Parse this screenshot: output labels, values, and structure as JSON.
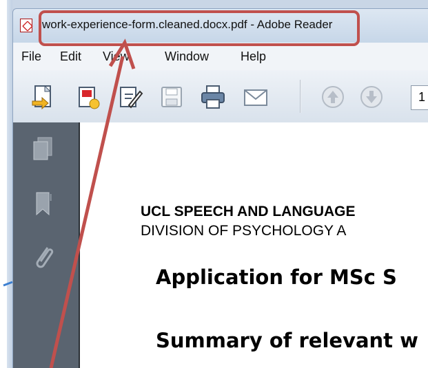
{
  "window": {
    "title": "work-experience-form.cleaned.docx.pdf - Adobe Reader"
  },
  "menu": {
    "items": [
      "File",
      "Edit",
      "View",
      "Window",
      "Help"
    ]
  },
  "toolbar": {
    "icons": [
      "open-icon",
      "create-pdf-icon",
      "sign-edit-icon",
      "save-icon",
      "print-icon",
      "email-icon",
      "previous-page-icon",
      "next-page-icon"
    ],
    "page_number": "1"
  },
  "nav_pane": {
    "icons": [
      "pages-icon",
      "bookmark-icon",
      "attachment-icon"
    ]
  },
  "document": {
    "line1": "UCL SPEECH AND LANGUAGE",
    "line2": "DIVISION OF PSYCHOLOGY A",
    "heading1": "Application for MSc S",
    "heading2": "Summary of relevant w"
  },
  "colors": {
    "highlight": "#c0504d",
    "nav_pane": "#5a6470",
    "title_bar": "#c6d6e8"
  }
}
